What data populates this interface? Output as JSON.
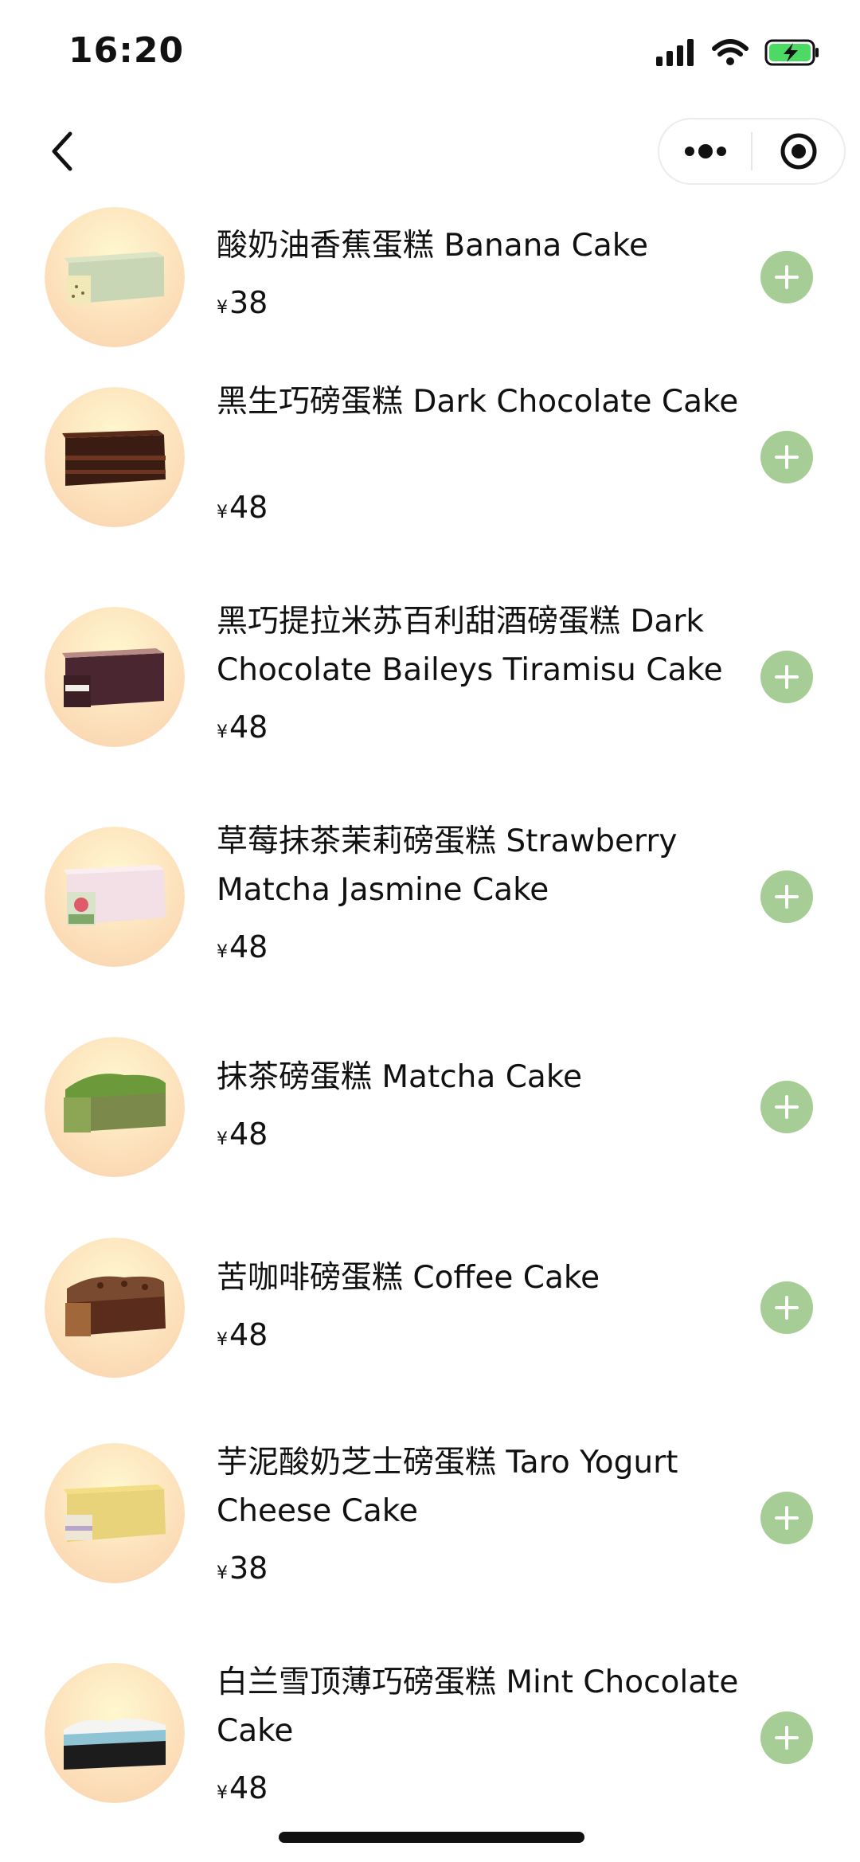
{
  "status_bar": {
    "time": "16:20"
  },
  "nav": {
    "back_icon": "chevron-left-icon",
    "more_icon": "more-dots-icon",
    "close_icon": "target-circle-icon"
  },
  "currency_symbol": "¥",
  "accent_color": "#a7cd96",
  "products": [
    {
      "name": "酸奶油香蕉蛋糕 Banana Cake",
      "price": "38",
      "icon": "banana-cake-icon"
    },
    {
      "name": "黑生巧磅蛋糕 Dark Chocolate Cake",
      "price": "48",
      "icon": "dark-chocolate-cake-icon"
    },
    {
      "name": "黑巧提拉米苏百利甜酒磅蛋糕 Dark Chocolate Baileys Tiramisu Cake",
      "price": "48",
      "icon": "tiramisu-cake-icon"
    },
    {
      "name": "草莓抹茶茉莉磅蛋糕 Strawberry Matcha Jasmine Cake",
      "price": "48",
      "icon": "strawberry-matcha-cake-icon"
    },
    {
      "name": "抹茶磅蛋糕 Matcha Cake",
      "price": "48",
      "icon": "matcha-cake-icon"
    },
    {
      "name": "苦咖啡磅蛋糕 Coffee Cake",
      "price": "48",
      "icon": "coffee-cake-icon"
    },
    {
      "name": "芋泥酸奶芝士磅蛋糕 Taro Yogurt Cheese Cake",
      "price": "38",
      "icon": "taro-cake-icon"
    },
    {
      "name": "白兰雪顶薄巧磅蛋糕 Mint Chocolate Cake",
      "price": "48",
      "icon": "mint-chocolate-cake-icon"
    }
  ]
}
